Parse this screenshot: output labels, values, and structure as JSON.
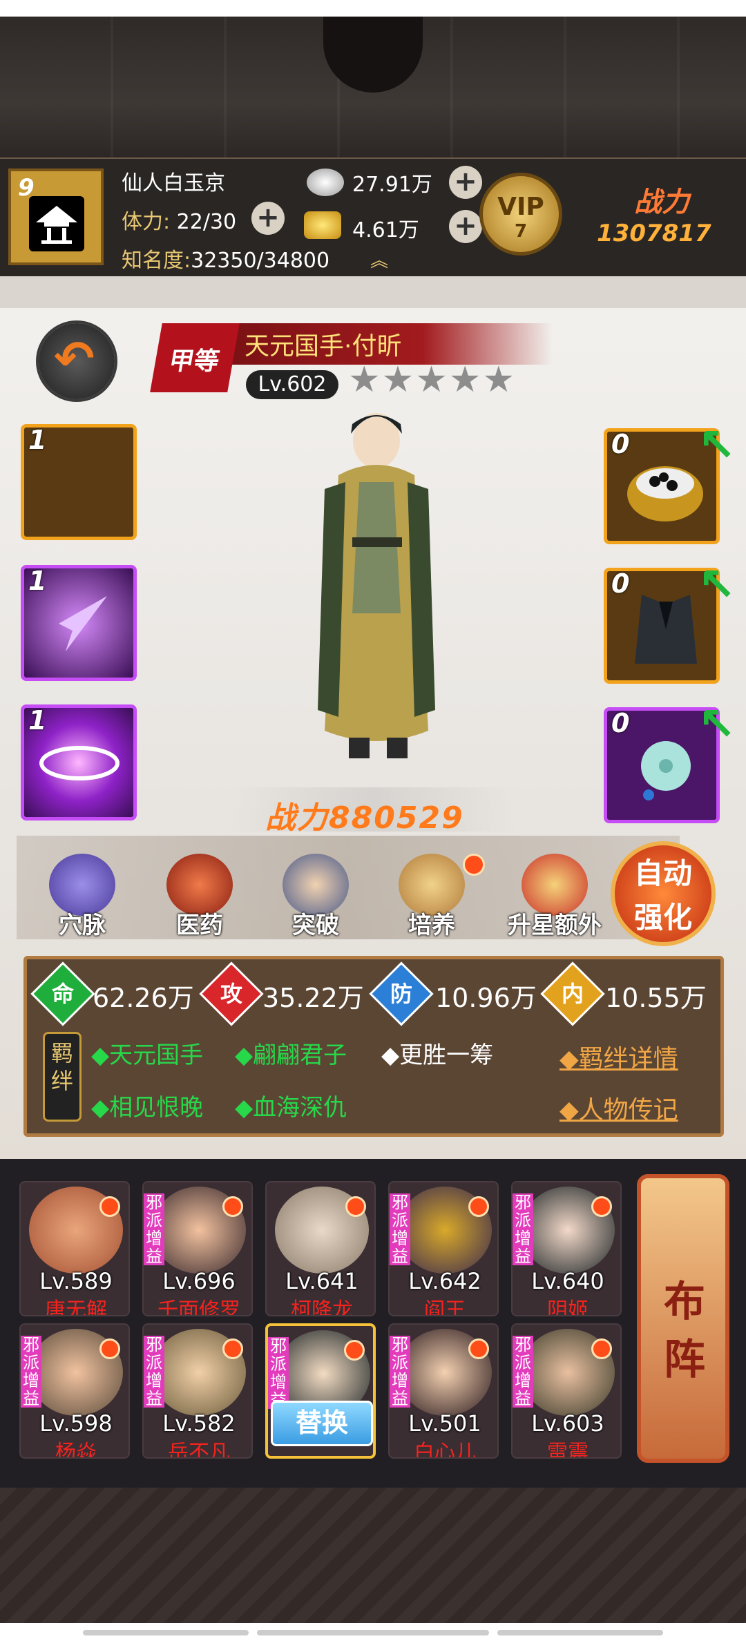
{
  "player": {
    "level": "9",
    "name": "仙人白玉京",
    "stamina_label": "体力:",
    "stamina_value": "22/30",
    "fame_label": "知名度:",
    "fame_value": "32350/34800",
    "silver": "27.91万",
    "gold": "4.61万",
    "vip_label": "VIP",
    "vip_level": "7",
    "power_label": "战力",
    "power_value": "1307817"
  },
  "hero": {
    "rank_badge": "甲等",
    "title": "天元国手·付昕",
    "level": "Lv.602",
    "stars": "★★★★★",
    "power_label": "战力",
    "power_value": "880529"
  },
  "left_slots": [
    {
      "count": "1",
      "icon": "empty-slot-icon"
    },
    {
      "count": "1",
      "icon": "arrowhead-skill-icon"
    },
    {
      "count": "1",
      "icon": "vortex-skill-icon"
    }
  ],
  "right_slots": [
    {
      "count": "0",
      "icon": "go-stone-bowl-icon"
    },
    {
      "count": "0",
      "icon": "armor-vest-icon"
    },
    {
      "count": "0",
      "icon": "jade-pendant-icon"
    }
  ],
  "functions": [
    {
      "label": "穴脉",
      "icon": "meridian-icon"
    },
    {
      "label": "医药",
      "icon": "herb-icon"
    },
    {
      "label": "突破",
      "icon": "breakthrough-icon"
    },
    {
      "label": "培养",
      "icon": "scroll-icon",
      "badge": true
    },
    {
      "label": "升星额外",
      "icon": "star-upgrade-icon"
    }
  ],
  "auto_enhance": {
    "line1": "自动",
    "line2": "强化"
  },
  "stats": [
    {
      "icon_label": "命",
      "value": "62.26万",
      "color": "#1fae3c"
    },
    {
      "icon_label": "攻",
      "value": "35.22万",
      "color": "#d8262b"
    },
    {
      "icon_label": "防",
      "value": "10.96万",
      "color": "#2b7fd6"
    },
    {
      "icon_label": "内",
      "value": "10.55万",
      "color": "#e2a21d"
    }
  ],
  "bond": {
    "label": "羁绊",
    "items": [
      {
        "text": "◆天元国手",
        "color": "#27d84a"
      },
      {
        "text": "◆翩翩君子",
        "color": "#27d84a"
      },
      {
        "text": "◆更胜一筹",
        "color": "#ffffff"
      },
      {
        "text": "◆相见恨晚",
        "color": "#27d84a"
      },
      {
        "text": "◆血海深仇",
        "color": "#27d84a"
      }
    ],
    "detail_link": "◆羁绊详情",
    "bio_link": "◆人物传记"
  },
  "roster": [
    {
      "level": "Lv.589",
      "name": "唐无解",
      "tag": ""
    },
    {
      "level": "Lv.696",
      "name": "千面修罗",
      "tag": "邪派增益"
    },
    {
      "level": "Lv.641",
      "name": "柯降龙",
      "tag": ""
    },
    {
      "level": "Lv.642",
      "name": "阎王",
      "tag": "邪派增益"
    },
    {
      "level": "Lv.640",
      "name": "阴姬",
      "tag": "邪派增益"
    },
    {
      "level": "Lv.598",
      "name": "杨焱",
      "tag": "邪派增益"
    },
    {
      "level": "Lv.582",
      "name": "岳不凡",
      "tag": "邪派增益"
    },
    {
      "level": "",
      "name": "",
      "tag": "邪派增益",
      "swap_label": "替换"
    },
    {
      "level": "Lv.501",
      "name": "白心儿",
      "tag": "邪派增益"
    },
    {
      "level": "Lv.603",
      "name": "雷震",
      "tag": "邪派增益"
    }
  ],
  "formation": {
    "line1": "布",
    "line2": "阵"
  }
}
